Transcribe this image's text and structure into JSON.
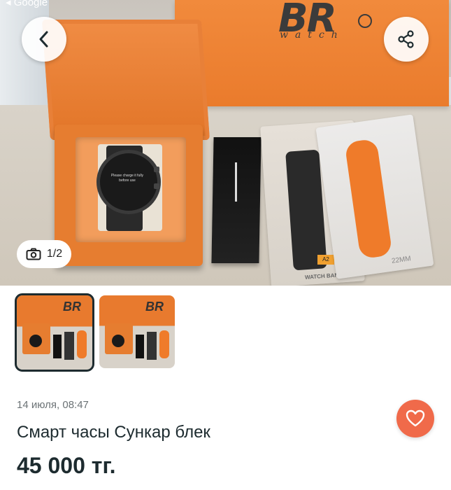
{
  "status_bar": {
    "back_app": "◂ Google"
  },
  "photo": {
    "counter": "1/2",
    "bag_brand": "BR",
    "bag_sub": "watch",
    "watch_screen_text": "Please charge it fully before use",
    "pack1_tag": "A2",
    "pack1_footer": "WATCH BAND",
    "pack2_footer": "22MM"
  },
  "icons": {
    "back": "chevron-left-icon",
    "share": "share-icon",
    "camera": "camera-icon",
    "favorite": "heart-icon"
  },
  "thumbnails": [
    {
      "label": "BR",
      "active": true
    },
    {
      "label": "BR",
      "active": false
    }
  ],
  "listing": {
    "date": "14 июля, 08:47",
    "title": "Смарт часы Сункар блек",
    "price": "45 000 тг."
  },
  "colors": {
    "accent": "#f06a4a",
    "text_dark": "#1d2b2f",
    "text_muted": "#6b7275"
  }
}
